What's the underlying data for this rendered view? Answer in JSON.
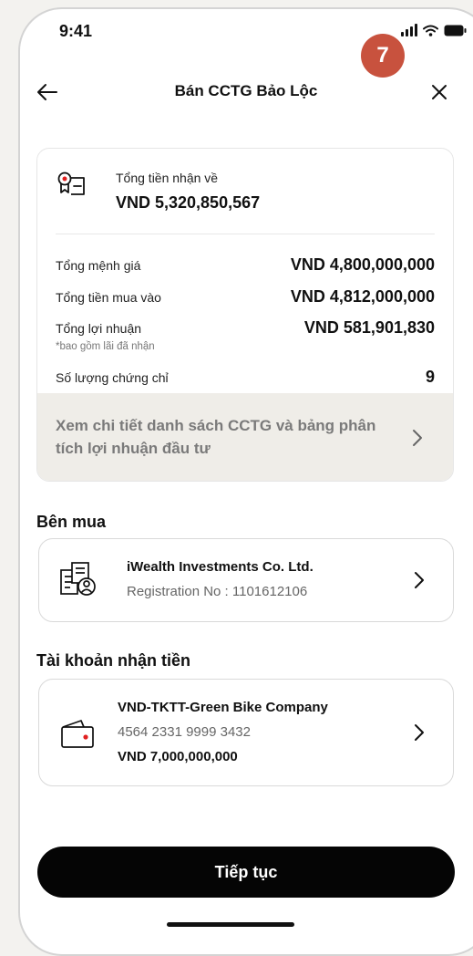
{
  "status_bar": {
    "time": "9:41"
  },
  "step_badge": "7",
  "header": {
    "back_icon": "arrow-left-icon",
    "title": "Bán CCTG Bảo Lộc",
    "close_icon": "close-icon"
  },
  "summary": {
    "total_received_label": "Tổng tiền nhận về",
    "total_received_value": "VND 5,320,850,567",
    "rows": [
      {
        "label": "Tổng mệnh giá",
        "value": "VND 4,800,000,000"
      },
      {
        "label": "Tổng tiền mua vào",
        "value": "VND 4,812,000,000"
      },
      {
        "label": "Tổng lợi nhuận",
        "value": "VND 581,901,830"
      },
      {
        "label": "Số lượng chứng chỉ",
        "value": "9"
      }
    ],
    "profit_note": "*bao gồm lãi đã nhận",
    "detail_link": "Xem chi tiết danh sách CCTG và bảng phân tích lợi nhuận đầu tư"
  },
  "buyer": {
    "section_title": "Bên mua",
    "name": "iWealth Investments Co. Ltd.",
    "registration": "Registration No : 1101612106"
  },
  "receiving_account": {
    "section_title": "Tài khoản nhận tiền",
    "name": "VND-TKTT-Green Bike Company",
    "number": "4564 2331 9999 3432",
    "balance": "VND 7,000,000,000"
  },
  "cta": {
    "label": "Tiếp tục"
  },
  "colors": {
    "badge": "#c8523e",
    "cta_bg": "#050505",
    "link_bg": "#efede8",
    "wallet_dot": "#e02020"
  }
}
